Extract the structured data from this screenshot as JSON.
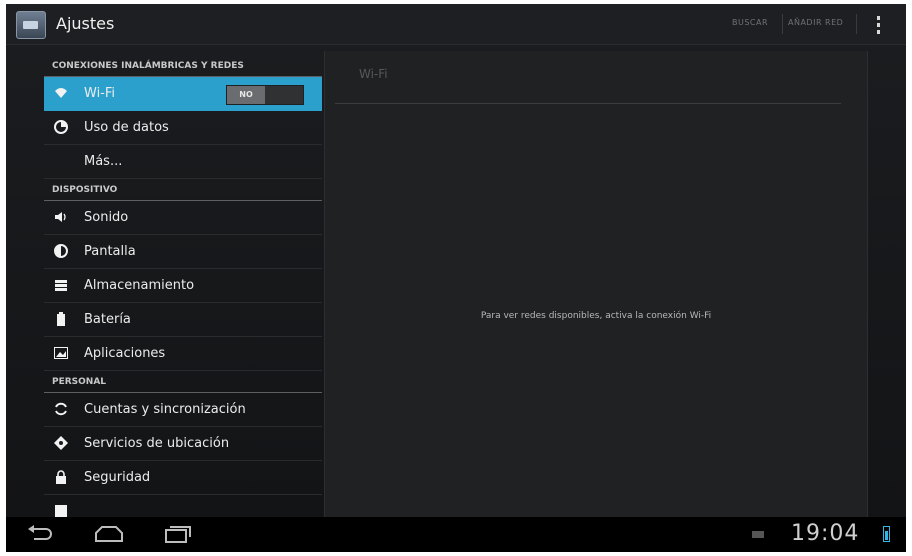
{
  "actionbar": {
    "title": "Ajustes",
    "actions": [
      "BUSCAR",
      "AÑADIR RED"
    ]
  },
  "sidebar": {
    "sections": [
      {
        "header": "CONEXIONES INALÁMBRICAS Y REDES",
        "items": [
          {
            "label": "Wi-Fi",
            "icon": "wifi-icon",
            "selected": true,
            "toggle": "NO"
          },
          {
            "label": "Uso de datos",
            "icon": "data-usage-icon"
          },
          {
            "label": "Más...",
            "icon": ""
          }
        ]
      },
      {
        "header": "DISPOSITIVO",
        "items": [
          {
            "label": "Sonido",
            "icon": "volume-icon"
          },
          {
            "label": "Pantalla",
            "icon": "display-icon"
          },
          {
            "label": "Almacenamiento",
            "icon": "storage-icon"
          },
          {
            "label": "Batería",
            "icon": "battery-icon"
          },
          {
            "label": "Aplicaciones",
            "icon": "apps-icon"
          }
        ]
      },
      {
        "header": "PERSONAL",
        "items": [
          {
            "label": "Cuentas y sincronización",
            "icon": "sync-icon"
          },
          {
            "label": "Servicios de ubicación",
            "icon": "location-icon"
          },
          {
            "label": "Seguridad",
            "icon": "lock-icon"
          }
        ]
      }
    ]
  },
  "detail": {
    "title": "Wi-Fi",
    "message": "Para ver redes disponibles, activa la conexión Wi-Fi"
  },
  "navbar": {
    "time": "19:04"
  },
  "colors": {
    "accent": "#2ba0cc",
    "battery": "#33b5e5"
  }
}
